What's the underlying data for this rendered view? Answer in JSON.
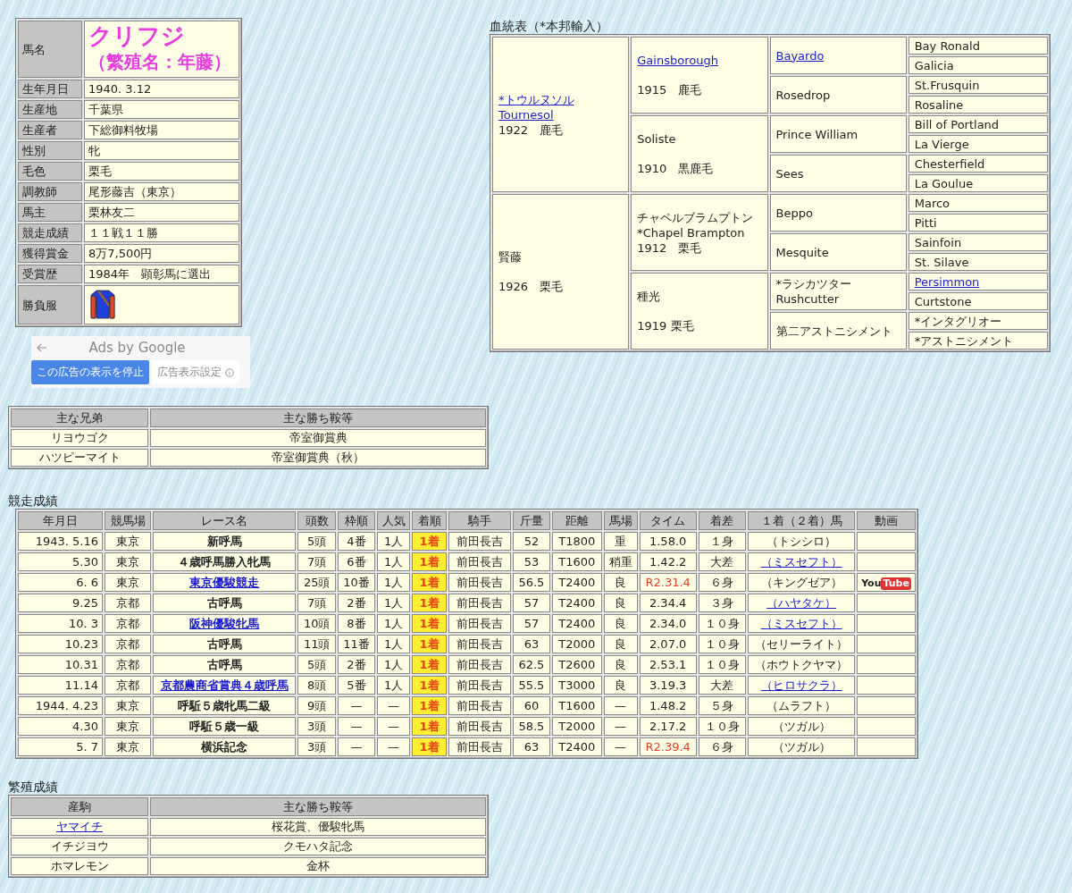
{
  "profile": {
    "name_label": "馬名",
    "name": "クリフジ",
    "breeding_name": "（繁殖名：年藤）",
    "rows": [
      {
        "kind": "text",
        "label": "生年月日",
        "value": "1940. 3.12"
      },
      {
        "kind": "text",
        "label": "生産地",
        "value": "千葉県"
      },
      {
        "kind": "text",
        "label": "生産者",
        "value": "下総御料牧場"
      },
      {
        "kind": "text",
        "label": "性別",
        "value": "牝"
      },
      {
        "kind": "text",
        "label": "毛色",
        "value": "栗毛"
      },
      {
        "kind": "text",
        "label": "調教師",
        "value": "尾形藤吉（東京）"
      },
      {
        "kind": "text",
        "label": "馬主",
        "value": "栗林友二"
      },
      {
        "kind": "text",
        "label": "競走成績",
        "value": "１１戦１１勝"
      },
      {
        "kind": "text",
        "label": "獲得賞金",
        "value": "8万7,500円"
      },
      {
        "kind": "text",
        "label": "受賞歴",
        "value": "1984年　顕彰馬に選出"
      },
      {
        "kind": "silks",
        "label": "勝負服"
      }
    ]
  },
  "ad": {
    "title": "Ads by Google",
    "stop_button": "この広告の表示を停止",
    "settings_button": "広告表示設定"
  },
  "pedigree": {
    "title": "血統表（*本邦輸入）",
    "ancestors": [
      {
        "names": [
          "*トウルヌソル",
          "Tournesol"
        ],
        "link": true,
        "info": "1922　鹿毛",
        "children": [
          {
            "names": [
              "Gainsborough"
            ],
            "link": true,
            "info": "1915　鹿毛",
            "children": [
              {
                "names": [
                  "Bayardo"
                ],
                "link": true,
                "children": [
                  {
                    "names": [
                      "Bay Ronald"
                    ],
                    "link": false
                  },
                  {
                    "names": [
                      "Galicia"
                    ],
                    "link": false
                  }
                ]
              },
              {
                "names": [
                  "Rosedrop"
                ],
                "link": false,
                "children": [
                  {
                    "names": [
                      "St.Frusquin"
                    ],
                    "link": false
                  },
                  {
                    "names": [
                      "Rosaline"
                    ],
                    "link": false
                  }
                ]
              }
            ]
          },
          {
            "names": [
              "Soliste"
            ],
            "link": false,
            "info": "1910　黒鹿毛",
            "children": [
              {
                "names": [
                  "Prince William"
                ],
                "link": false,
                "children": [
                  {
                    "names": [
                      "Bill of Portland"
                    ],
                    "link": false
                  },
                  {
                    "names": [
                      "La Vierge"
                    ],
                    "link": false
                  }
                ]
              },
              {
                "names": [
                  "Sees"
                ],
                "link": false,
                "children": [
                  {
                    "names": [
                      "Chesterfield"
                    ],
                    "link": false
                  },
                  {
                    "names": [
                      "La Goulue"
                    ],
                    "link": false
                  }
                ]
              }
            ]
          }
        ]
      },
      {
        "names": [
          "賢藤"
        ],
        "link": false,
        "info": "1926　栗毛",
        "children": [
          {
            "names": [
              "チャペルブラムプトン",
              "*Chapel Brampton"
            ],
            "link": false,
            "info": "1912　栗毛",
            "children": [
              {
                "names": [
                  "Beppo"
                ],
                "link": false,
                "children": [
                  {
                    "names": [
                      "Marco"
                    ],
                    "link": false
                  },
                  {
                    "names": [
                      "Pitti"
                    ],
                    "link": false
                  }
                ]
              },
              {
                "names": [
                  "Mesquite"
                ],
                "link": false,
                "children": [
                  {
                    "names": [
                      "Sainfoin"
                    ],
                    "link": false
                  },
                  {
                    "names": [
                      "St. Silave"
                    ],
                    "link": false
                  }
                ]
              }
            ]
          },
          {
            "names": [
              "種光"
            ],
            "link": false,
            "info": "1919 栗毛",
            "children": [
              {
                "names": [
                  "*ラシカツター",
                  "Rushcutter"
                ],
                "link": false,
                "children": [
                  {
                    "names": [
                      "Persimmon"
                    ],
                    "link": true
                  },
                  {
                    "names": [
                      "Curtstone"
                    ],
                    "link": false
                  }
                ]
              },
              {
                "names": [
                  "第二アストニシメント"
                ],
                "link": false,
                "children": [
                  {
                    "names": [
                      "*インタグリオー"
                    ],
                    "link": false
                  },
                  {
                    "names": [
                      "*アストニシメント"
                    ],
                    "link": false
                  }
                ]
              }
            ]
          }
        ]
      }
    ]
  },
  "siblings": {
    "columns": [
      "主な兄弟",
      "主な勝ち鞍等"
    ],
    "rows": [
      {
        "name": "リヨウゴク",
        "link": false,
        "wins": "帝室御賞典"
      },
      {
        "name": "ハツピーマイト",
        "link": false,
        "wins": "帝室御賞典（秋）"
      }
    ]
  },
  "races": {
    "title": "競走成績",
    "columns": [
      "年月日",
      "競馬場",
      "レース名",
      "頭数",
      "枠順",
      "人気",
      "着順",
      "騎手",
      "斤量",
      "距離",
      "馬場",
      "タイム",
      "着差",
      "１着（２着）馬",
      "動画"
    ],
    "rows": [
      {
        "date": "1943. 5.16",
        "course": "東京",
        "race": "新呼馬",
        "race_link": false,
        "runners": "5頭",
        "gate": "4番",
        "popularity": "1人",
        "finish": "1着",
        "jockey": "前田長吉",
        "weight": "52",
        "distance": "T1800",
        "track": "重",
        "time": "1.58.0",
        "record": false,
        "margin": "１身",
        "rival": "（トシシロ）",
        "rival_link": false
      },
      {
        "date": "5.30",
        "course": "東京",
        "race": "４歳呼馬勝入牝馬",
        "race_link": false,
        "runners": "7頭",
        "gate": "6番",
        "popularity": "1人",
        "finish": "1着",
        "jockey": "前田長吉",
        "weight": "53",
        "distance": "T1600",
        "track": "稍重",
        "time": "1.42.2",
        "record": false,
        "margin": "大差",
        "rival": "（ミスセフト）",
        "rival_link": true
      },
      {
        "date": "6. 6",
        "course": "東京",
        "race": "東京優駿競走",
        "race_link": true,
        "runners": "25頭",
        "gate": "10番",
        "popularity": "1人",
        "finish": "1着",
        "jockey": "前田長吉",
        "weight": "56.5",
        "distance": "T2400",
        "track": "良",
        "time": "R2.31.4",
        "record": true,
        "margin": "６身",
        "rival": "（キングゼア）",
        "rival_link": false,
        "video": [
          "You",
          "Tube"
        ]
      },
      {
        "date": "9.25",
        "course": "京都",
        "race": "古呼馬",
        "race_link": false,
        "runners": "7頭",
        "gate": "2番",
        "popularity": "1人",
        "finish": "1着",
        "jockey": "前田長吉",
        "weight": "57",
        "distance": "T2400",
        "track": "良",
        "time": "2.34.4",
        "record": false,
        "margin": "３身",
        "rival": "（ハヤタケ）",
        "rival_link": true
      },
      {
        "date": "10. 3",
        "course": "京都",
        "race": "阪神優駿牝馬",
        "race_link": true,
        "runners": "10頭",
        "gate": "8番",
        "popularity": "1人",
        "finish": "1着",
        "jockey": "前田長吉",
        "weight": "57",
        "distance": "T2400",
        "track": "良",
        "time": "2.34.0",
        "record": false,
        "margin": "１０身",
        "rival": "（ミスセフト）",
        "rival_link": true
      },
      {
        "date": "10.23",
        "course": "京都",
        "race": "古呼馬",
        "race_link": false,
        "runners": "11頭",
        "gate": "11番",
        "popularity": "1人",
        "finish": "1着",
        "jockey": "前田長吉",
        "weight": "63",
        "distance": "T2000",
        "track": "良",
        "time": "2.07.0",
        "record": false,
        "margin": "１０身",
        "rival": "（セリーライト）",
        "rival_link": false
      },
      {
        "date": "10.31",
        "course": "京都",
        "race": "古呼馬",
        "race_link": false,
        "runners": "5頭",
        "gate": "2番",
        "popularity": "1人",
        "finish": "1着",
        "jockey": "前田長吉",
        "weight": "62.5",
        "distance": "T2600",
        "track": "良",
        "time": "2.53.1",
        "record": false,
        "margin": "１０身",
        "rival": "（ホウトクヤマ）",
        "rival_link": false
      },
      {
        "date": "11.14",
        "course": "京都",
        "race": "京都農商省賞典４歳呼馬",
        "race_link": true,
        "runners": "8頭",
        "gate": "5番",
        "popularity": "1人",
        "finish": "1着",
        "jockey": "前田長吉",
        "weight": "55.5",
        "distance": "T3000",
        "track": "良",
        "time": "3.19.3",
        "record": false,
        "margin": "大差",
        "rival": "（ヒロサクラ）",
        "rival_link": true
      },
      {
        "date": "1944. 4.23",
        "course": "東京",
        "race": "呼駈５歳牝馬二級",
        "race_link": false,
        "runners": "9頭",
        "gate": "—",
        "popularity": "—",
        "finish": "1着",
        "jockey": "前田長吉",
        "weight": "60",
        "distance": "T1600",
        "track": "—",
        "time": "1.48.2",
        "record": false,
        "margin": "５身",
        "rival": "（ムラフト）",
        "rival_link": false
      },
      {
        "date": "4.30",
        "course": "東京",
        "race": "呼駈５歳一級",
        "race_link": false,
        "runners": "3頭",
        "gate": "—",
        "popularity": "—",
        "finish": "1着",
        "jockey": "前田長吉",
        "weight": "58.5",
        "distance": "T2000",
        "track": "—",
        "time": "2.17.2",
        "record": false,
        "margin": "１０身",
        "rival": "（ツガル）",
        "rival_link": false
      },
      {
        "date": "5. 7",
        "course": "東京",
        "race": "横浜記念",
        "race_link": false,
        "runners": "3頭",
        "gate": "—",
        "popularity": "—",
        "finish": "1着",
        "jockey": "前田長吉",
        "weight": "63",
        "distance": "T2400",
        "track": "—",
        "time": "R2.39.4",
        "record": true,
        "margin": "６身",
        "rival": "（ツガル）",
        "rival_link": false
      }
    ]
  },
  "offspring": {
    "title": "繁殖成績",
    "columns": [
      "産駒",
      "主な勝ち鞍等"
    ],
    "rows": [
      {
        "name": "ヤマイチ",
        "link": true,
        "wins": "桜花賞、優駿牝馬"
      },
      {
        "name": "イチジヨウ",
        "link": false,
        "wins": "クモハタ記念"
      },
      {
        "name": "ホマレモン",
        "link": false,
        "wins": "金杯"
      }
    ]
  }
}
